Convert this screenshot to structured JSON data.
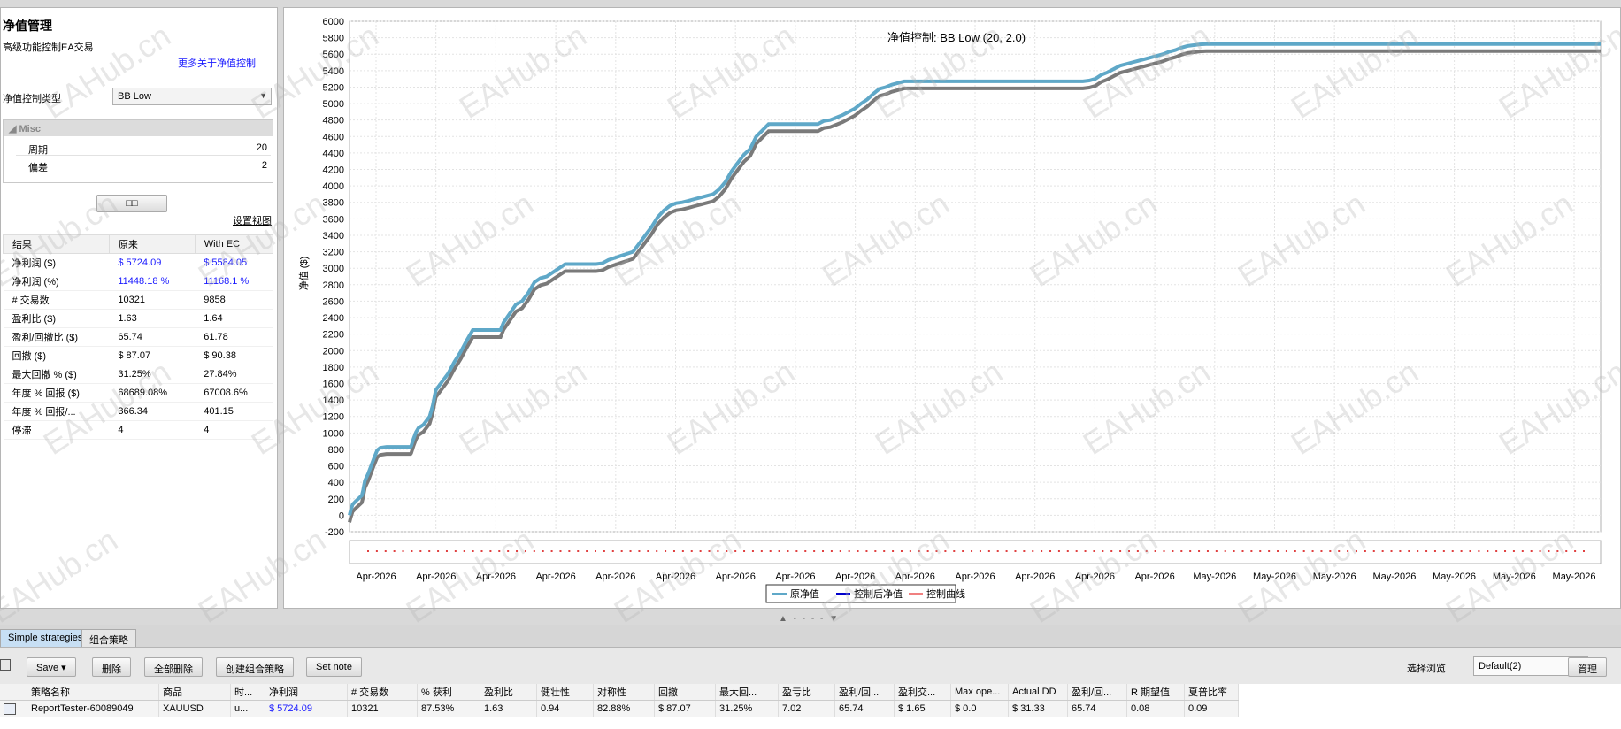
{
  "left_panel": {
    "title": "净值管理",
    "subtitle": "高级功能控制EA交易",
    "more_link": "更多关于净值控制",
    "ec_type_label": "净值控制类型",
    "ec_type_value": "BB Low",
    "misc": {
      "header": "Misc",
      "rows": [
        {
          "key": "周期",
          "value": "20"
        },
        {
          "key": "偏差",
          "value": "2"
        }
      ]
    },
    "layout_button": "□□",
    "set_view": "设置视图",
    "stats": {
      "headers": [
        "结果",
        "原来",
        "With EC"
      ],
      "rows": [
        [
          "净利润 ($)",
          "$ 5724.09",
          "$ 5584.05"
        ],
        [
          "净利润 (%)",
          "11448.18 %",
          "11168.1 %"
        ],
        [
          "# 交易数",
          "10321",
          "9858"
        ],
        [
          "盈利比 ($)",
          "1.63",
          "1.64"
        ],
        [
          "盈利/回撤比 ($)",
          "65.74",
          "61.78"
        ],
        [
          "回撤 ($)",
          "$ 87.07",
          "$ 90.38"
        ],
        [
          "最大回撤 % ($)",
          "31.25%",
          "27.84%"
        ],
        [
          "年度 % 回报 ($)",
          "68689.08%",
          "67008.6%"
        ],
        [
          "年度 % 回报/...",
          "366.34",
          "401.15"
        ],
        [
          "停滞",
          "4",
          "4"
        ]
      ],
      "blue_rows": [
        0,
        1
      ]
    }
  },
  "chart_data": {
    "type": "line",
    "title": "净值控制: BB Low (20, 2.0)",
    "ylabel": "净值 ($)",
    "ylim": [
      -200,
      6000
    ],
    "yticks": [
      -200,
      0,
      200,
      400,
      600,
      800,
      1000,
      1200,
      1400,
      1600,
      1800,
      2000,
      2200,
      2400,
      2600,
      2800,
      3000,
      3200,
      3400,
      3600,
      3800,
      4000,
      4200,
      4400,
      4600,
      4800,
      5000,
      5200,
      5400,
      5600,
      5800,
      6000
    ],
    "xticks": [
      "Apr-2026",
      "Apr-2026",
      "Apr-2026",
      "Apr-2026",
      "Apr-2026",
      "Apr-2026",
      "Apr-2026",
      "Apr-2026",
      "Apr-2026",
      "Apr-2026",
      "Apr-2026",
      "Apr-2026",
      "Apr-2026",
      "Apr-2026",
      "May-2026",
      "May-2026",
      "May-2026",
      "May-2026",
      "May-2026",
      "May-2026",
      "May-2026"
    ],
    "grid": true,
    "legend_position": "bottom-center",
    "x": [
      0,
      0.02,
      0.05,
      0.1,
      0.2,
      0.22,
      0.25,
      0.3,
      0.4,
      0.45,
      0.5,
      0.6,
      0.75,
      0.85,
      0.9,
      0.95,
      0.99,
      1.0,
      1.04,
      1.08,
      1.12,
      1.2,
      1.3,
      1.35,
      1.4,
      1.5,
      1.6,
      1.7,
      1.8,
      1.85,
      1.9,
      2.0,
      2.1,
      2.2,
      2.3,
      2.4,
      2.45,
      2.5,
      2.6,
      2.7,
      2.8,
      2.9,
      3.0,
      3.1,
      3.2,
      3.3,
      3.4,
      3.5,
      3.55,
      3.6,
      3.7,
      3.8,
      3.9,
      4.0,
      4.1,
      4.2,
      4.4,
      4.6,
      4.7,
      4.8,
      4.9,
      5.0,
      5.1,
      5.2,
      5.3,
      5.4,
      5.5,
      5.6,
      5.7,
      5.8,
      5.9,
      6.0,
      6.1,
      6.2,
      6.3,
      6.4,
      6.5,
      6.6,
      6.8,
      7.0,
      7.2,
      7.3,
      7.35,
      7.5,
      7.6,
      7.7,
      7.8,
      7.9,
      8.0,
      8.1,
      8.2,
      8.3,
      8.4,
      8.5,
      8.6,
      8.7,
      8.8,
      8.9,
      9.0,
      9.2,
      9.4,
      9.5,
      9.6,
      9.7,
      9.8,
      10.0,
      10.5,
      11.0,
      11.5,
      11.9,
      12.0,
      12.1,
      12.2,
      12.3,
      12.4,
      12.5,
      12.6,
      12.7,
      12.8,
      12.9,
      13.0,
      13.1,
      13.2,
      13.3,
      13.4,
      13.5,
      13.6,
      13.7,
      13.8,
      13.9,
      14.0,
      14.5,
      14.9,
      15.0,
      15.1,
      15.2,
      15.3,
      15.4,
      15.5,
      15.6,
      15.7,
      15.8,
      15.9,
      16.0,
      16.1,
      16.2,
      16.3,
      16.4,
      16.5,
      16.6,
      16.7,
      16.8,
      17.0,
      17.2,
      17.4,
      17.6,
      17.8,
      18.0,
      18.2,
      18.4,
      18.6,
      18.8,
      19.0,
      19.2,
      19.4,
      19.6,
      19.8,
      20.0,
      20.2,
      20.3
    ],
    "series": [
      {
        "name": "原净值",
        "color": "#5fa8c8",
        "values": [
          0,
          60,
          130,
          170,
          240,
          300,
          420,
          500,
          700,
          790,
          820,
          830,
          830,
          830,
          830,
          830,
          830,
          840,
          930,
          1010,
          1060,
          1100,
          1200,
          1330,
          1520,
          1620,
          1720,
          1860,
          1980,
          2050,
          2120,
          2250,
          2250,
          2250,
          2250,
          2250,
          2250,
          2340,
          2450,
          2560,
          2600,
          2700,
          2830,
          2880,
          2900,
          2950,
          3000,
          3050,
          3050,
          3050,
          3050,
          3050,
          3050,
          3050,
          3060,
          3100,
          3150,
          3200,
          3300,
          3400,
          3500,
          3620,
          3700,
          3760,
          3790,
          3800,
          3820,
          3840,
          3860,
          3880,
          3900,
          3960,
          4050,
          4180,
          4280,
          4380,
          4450,
          4600,
          4750,
          4750,
          4750,
          4750,
          4750,
          4750,
          4750,
          4790,
          4800,
          4830,
          4860,
          4900,
          4940,
          5000,
          5050,
          5120,
          5180,
          5200,
          5230,
          5250,
          5270,
          5270,
          5270,
          5270,
          5270,
          5270,
          5270,
          5270,
          5270,
          5270,
          5270,
          5270,
          5280,
          5300,
          5350,
          5380,
          5420,
          5460,
          5480,
          5500,
          5520,
          5540,
          5560,
          5580,
          5600,
          5630,
          5650,
          5680,
          5700,
          5710,
          5720,
          5724,
          5724,
          5724,
          5724,
          5724,
          5724,
          5724,
          5724,
          5724,
          5724,
          5724,
          5724,
          5724,
          5724,
          5724,
          5724,
          5724,
          5724,
          5724,
          5724,
          5724,
          5724,
          5724,
          5724,
          5724,
          5724,
          5724,
          5724,
          5724,
          5724,
          5724,
          5724,
          5724,
          5724,
          5724,
          5724,
          5724,
          5724,
          5724,
          5724,
          5724
        ]
      }
    ]
  },
  "chart_legend": {
    "items": [
      {
        "label": "原净值",
        "color": "#5fa8c8"
      },
      {
        "label": "控制后净值",
        "color": "#0000cc"
      },
      {
        "label": "控制曲线",
        "color": "#f08080"
      }
    ]
  },
  "splitter": "▲ - - - - ▼",
  "tabs": [
    "Simple strategies",
    "组合策略"
  ],
  "toolbar": {
    "save": "Save ▾",
    "delete": "删除",
    "delete_all": "全部删除",
    "create_combo": "创建组合策略",
    "set_note": "Set note",
    "browse_label": "选择浏览",
    "browse_value": "Default(2)",
    "manage": "管理"
  },
  "results_table": {
    "headers": [
      "",
      "策略名称",
      "商品",
      "时...",
      "净利润",
      "# 交易数",
      "% 获利",
      "盈利比",
      "健壮性",
      "对称性",
      "回撤",
      "最大回...",
      "盈亏比",
      "盈利/回...",
      "盈利交...",
      "Max ope...",
      "Actual DD",
      "盈利/回...",
      "R 期望值",
      "夏普比率"
    ],
    "row": [
      "",
      "ReportTester-60089049",
      "XAUUSD",
      "u...",
      "$ 5724.09",
      "10321",
      "87.53%",
      "1.63",
      "0.94",
      "82.88%",
      "$ 87.07",
      "31.25%",
      "7.02",
      "65.74",
      "$ 1.65",
      "$ 0.0",
      "$ 31.33",
      "65.74",
      "0.08",
      "0.09"
    ]
  },
  "watermark": "EAHub.cn"
}
